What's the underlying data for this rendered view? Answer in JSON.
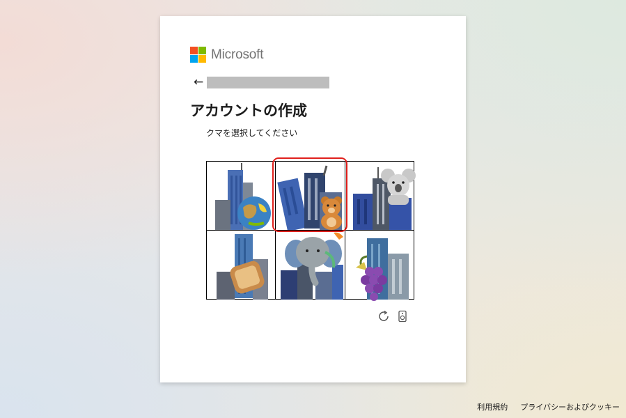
{
  "logo": {
    "text": "Microsoft",
    "colors": [
      "#f25022",
      "#7fba00",
      "#00a4ef",
      "#ffb900"
    ]
  },
  "header": {
    "back_icon": "back-arrow-icon",
    "email_masked": ""
  },
  "title": "アカウントの作成",
  "prompt": "クマを選択してください",
  "puzzle": {
    "tiles": [
      {
        "subject": "globe",
        "selected": false
      },
      {
        "subject": "bear",
        "selected": true
      },
      {
        "subject": "koala",
        "selected": false
      },
      {
        "subject": "bread",
        "selected": false
      },
      {
        "subject": "elephant",
        "selected": false
      },
      {
        "subject": "grapes",
        "selected": false
      }
    ],
    "selection_color": "#e0201c"
  },
  "controls": {
    "refresh_icon": "refresh-icon",
    "audio_icon": "audio-icon"
  },
  "footer": {
    "terms": "利用規約",
    "privacy": "プライバシーおよびクッキー"
  }
}
